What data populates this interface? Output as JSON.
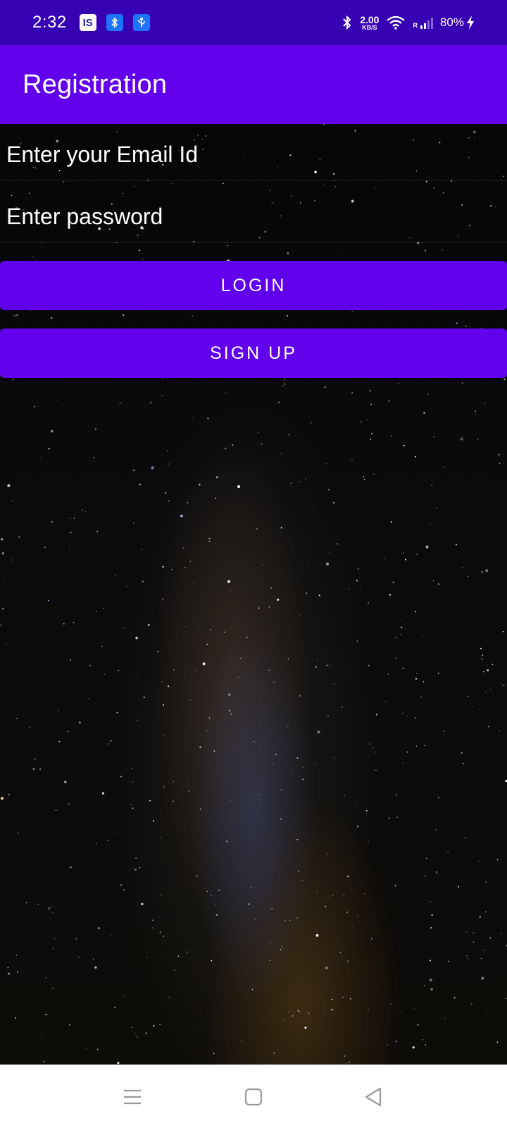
{
  "status_bar": {
    "time": "2:32",
    "notification_icons": [
      "IS",
      "bluetooth-notification-icon",
      "usb-notification-icon"
    ],
    "notif_is_label": "IS",
    "network_speed_value": "2.00",
    "network_speed_unit": "KB/S",
    "roaming_label": "R",
    "battery": "80%"
  },
  "app_bar": {
    "title": "Registration"
  },
  "form": {
    "email_placeholder": "Enter your Email Id",
    "email_value": "",
    "password_placeholder": "Enter password",
    "password_value": "",
    "login_label": "LOGIN",
    "signup_label": "SIGN UP"
  },
  "nav_bar": {
    "icons": [
      "menu-icon",
      "home-square-icon",
      "back-triangle-icon"
    ]
  },
  "colors": {
    "status_bar": "#3700b3",
    "primary": "#6200ee",
    "nav_bar": "#ffffff",
    "text_on_primary": "#ffffff"
  }
}
